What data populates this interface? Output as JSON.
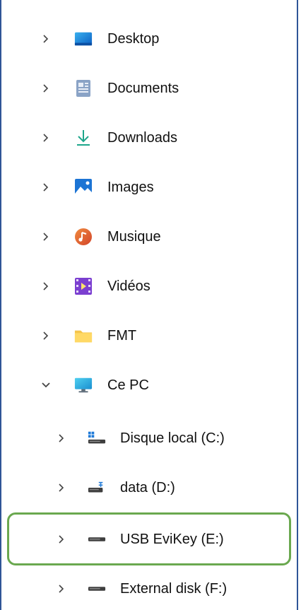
{
  "nav_tree": {
    "items": [
      {
        "label": "Desktop",
        "icon": "desktop-folder-icon",
        "expanded": false
      },
      {
        "label": "Documents",
        "icon": "documents-folder-icon",
        "expanded": false
      },
      {
        "label": "Downloads",
        "icon": "download-arrow-icon",
        "expanded": false
      },
      {
        "label": "Images",
        "icon": "pictures-folder-icon",
        "expanded": false
      },
      {
        "label": "Musique",
        "icon": "music-icon",
        "expanded": false
      },
      {
        "label": "Vidéos",
        "icon": "videos-folder-icon",
        "expanded": false
      },
      {
        "label": "FMT",
        "icon": "folder-icon",
        "expanded": false
      },
      {
        "label": "Ce PC",
        "icon": "monitor-icon",
        "expanded": true
      },
      {
        "label": "Disque local (C:)",
        "icon": "windows-drive-icon",
        "expanded": false
      },
      {
        "label": "data (D:)",
        "icon": "network-drive-icon",
        "expanded": false
      },
      {
        "label": "USB EviKey (E:)",
        "icon": "usb-drive-icon",
        "expanded": false,
        "highlighted": true
      },
      {
        "label": "External disk (F:)",
        "icon": "external-drive-icon",
        "expanded": false
      }
    ]
  },
  "colors": {
    "frame_border": "#2f5597",
    "highlight_border": "#6aa84f",
    "chevron": "#444444",
    "text": "#111111"
  }
}
